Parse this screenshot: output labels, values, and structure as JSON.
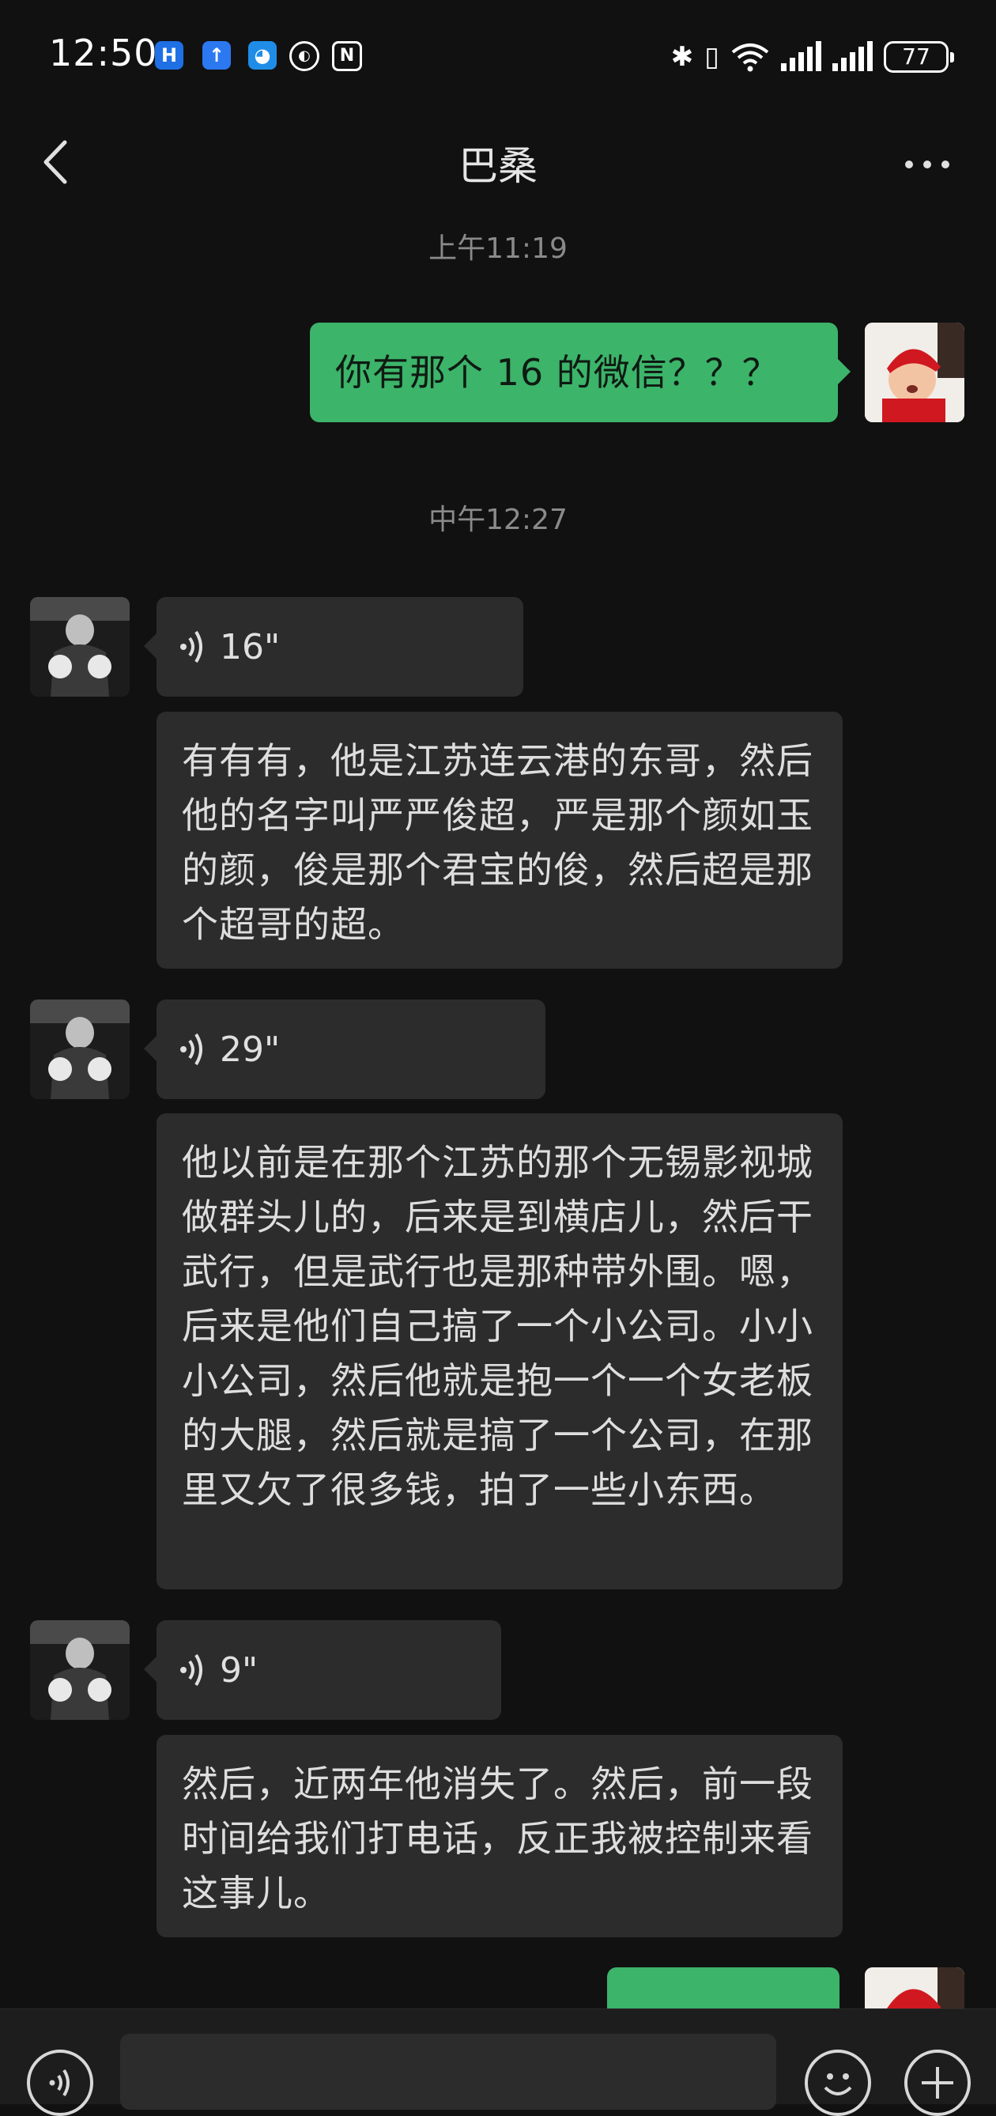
{
  "status_bar": {
    "time": "12:50",
    "battery": "77",
    "icons": [
      "app-h-icon",
      "upload-icon",
      "qq-icon",
      "kuaishou-icon",
      "nfc-icon",
      "bluetooth-icon",
      "vibrate-icon",
      "wifi-icon",
      "signal-icon",
      "signal-icon-2",
      "battery-icon"
    ]
  },
  "header": {
    "title": "巴桑"
  },
  "timestamps": {
    "first": "上午11:19",
    "second": "中午12:27"
  },
  "messages": {
    "m1": "你有那个 16 的微信？？？",
    "v1": "16\"",
    "t1": "有有有，他是江苏连云港的东哥，然后他的名字叫严严俊超，严是那个颜如玉的颜，俊是那个君宝的俊，然后超是那个超哥的超。",
    "v2": "29\"",
    "t2": "他以前是在那个江苏的那个无锡影视城做群头儿的，后来是到横店儿，然后干武行，但是武行也是那种带外围。嗯，后来是他们自己搞了一个小公司。小小小公司，然后他就是抱一个一个女老板的大腿，然后就是搞了一个公司，在那里又欠了很多钱，拍了一些小东西。",
    "v3": "9\"",
    "t3": "然后，近两年他消失了。然后，前一段时间给我们打电话，反正我被控制来看这事儿。"
  },
  "colors": {
    "self_bubble": "#3cb46a",
    "other_bubble": "#2c2c2c",
    "background": "#111111"
  }
}
